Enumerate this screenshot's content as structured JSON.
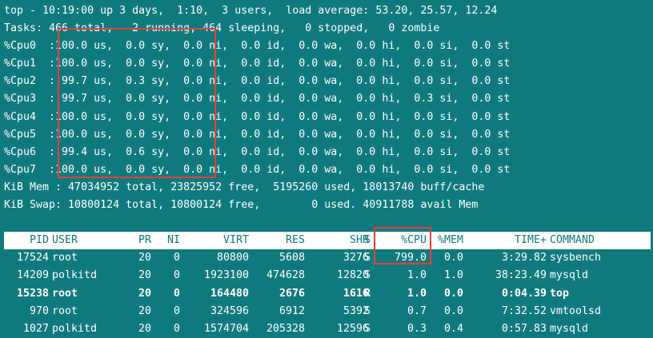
{
  "summary": {
    "top_line": "top - 10:19:00 up 3 days,  1:10,  3 users,  load average: 53.20, 25.57, 12.24",
    "tasks_line": "Tasks: 466 total,   2 running, 464 sleeping,   0 stopped,   0 zombie",
    "cpus": [
      "%Cpu0  :100.0 us,  0.0 sy,  0.0 ni,  0.0 id,  0.0 wa,  0.0 hi,  0.0 si,  0.0 st",
      "%Cpu1  :100.0 us,  0.0 sy,  0.0 ni,  0.0 id,  0.0 wa,  0.0 hi,  0.0 si,  0.0 st",
      "%Cpu2  : 99.7 us,  0.3 sy,  0.0 ni,  0.0 id,  0.0 wa,  0.0 hi,  0.0 si,  0.0 st",
      "%Cpu3  : 99.7 us,  0.0 sy,  0.0 ni,  0.0 id,  0.0 wa,  0.0 hi,  0.3 si,  0.0 st",
      "%Cpu4  :100.0 us,  0.0 sy,  0.0 ni,  0.0 id,  0.0 wa,  0.0 hi,  0.0 si,  0.0 st",
      "%Cpu5  :100.0 us,  0.0 sy,  0.0 ni,  0.0 id,  0.0 wa,  0.0 hi,  0.0 si,  0.0 st",
      "%Cpu6  : 99.4 us,  0.6 sy,  0.0 ni,  0.0 id,  0.0 wa,  0.0 hi,  0.0 si,  0.0 st",
      "%Cpu7  :100.0 us,  0.0 sy,  0.0 ni,  0.0 id,  0.0 wa,  0.0 hi,  0.0 si,  0.0 st"
    ],
    "mem_line": "KiB Mem : 47034952 total, 23825952 free,  5195260 used, 18013740 buff/cache",
    "swap_line": "KiB Swap: 10800124 total, 10800124 free,        0 used. 40911788 avail Mem"
  },
  "table": {
    "headers": {
      "pid": "PID",
      "user": "USER",
      "pr": "PR",
      "ni": "NI",
      "virt": "VIRT",
      "res": "RES",
      "shr": "SHR",
      "s": "S",
      "cpu": "%CPU",
      "mem": "%MEM",
      "time": "TIME+",
      "cmd": "COMMAND"
    },
    "rows": [
      {
        "pid": "17524",
        "user": "root",
        "pr": "20",
        "ni": "0",
        "virt": "80800",
        "res": "5608",
        "shr": "3276",
        "s": "S",
        "cpu": "799.0",
        "mem": "0.0",
        "time": "3:29.82",
        "cmd": "sysbench",
        "bold": false
      },
      {
        "pid": "14209",
        "user": "polkitd",
        "pr": "20",
        "ni": "0",
        "virt": "1923100",
        "res": "474628",
        "shr": "12820",
        "s": "S",
        "cpu": "1.0",
        "mem": "1.0",
        "time": "38:23.49",
        "cmd": "mysqld",
        "bold": false
      },
      {
        "pid": "15238",
        "user": "root",
        "pr": "20",
        "ni": "0",
        "virt": "164480",
        "res": "2676",
        "shr": "1616",
        "s": "R",
        "cpu": "1.0",
        "mem": "0.0",
        "time": "0:04.39",
        "cmd": "top",
        "bold": true
      },
      {
        "pid": "970",
        "user": "root",
        "pr": "20",
        "ni": "0",
        "virt": "324596",
        "res": "6912",
        "shr": "5392",
        "s": "S",
        "cpu": "0.7",
        "mem": "0.0",
        "time": "7:32.52",
        "cmd": "vmtoolsd",
        "bold": false
      },
      {
        "pid": "1027",
        "user": "polkitd",
        "pr": "20",
        "ni": "0",
        "virt": "1574704",
        "res": "205328",
        "shr": "12596",
        "s": "S",
        "cpu": "0.3",
        "mem": "0.4",
        "time": "0:57.83",
        "cmd": "mysqld",
        "bold": false
      }
    ]
  },
  "colors": {
    "background": "#0f7a7d",
    "foreground": "#ffffff",
    "highlight_box": "#e8403a"
  }
}
